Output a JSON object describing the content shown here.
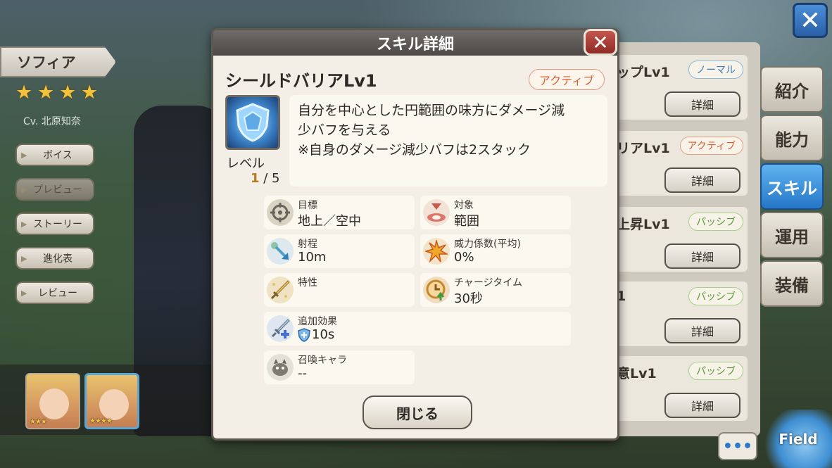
{
  "character": {
    "name": "ソフィア",
    "rarity_stars": 4,
    "cv": "Cv. 北原知奈"
  },
  "left_menu": [
    {
      "label": "ボイス",
      "enabled": true
    },
    {
      "label": "プレビュー",
      "enabled": false
    },
    {
      "label": "ストーリー",
      "enabled": true
    },
    {
      "label": "進化表",
      "enabled": true
    },
    {
      "label": "レビュー",
      "enabled": true
    }
  ],
  "portraits": [
    {
      "stars": "★★★",
      "selected": false
    },
    {
      "stars": "★★★★",
      "selected": true
    }
  ],
  "skill_list": [
    {
      "title": "ップLv1",
      "badge": "ノーマル",
      "badge_type": "normal",
      "button": "詳細"
    },
    {
      "title": "リアLv1",
      "badge": "アクティブ",
      "badge_type": "active",
      "button": "詳細"
    },
    {
      "title": "上昇Lv1",
      "badge": "パッシブ",
      "badge_type": "passive",
      "button": "詳細"
    },
    {
      "title": "1",
      "badge": "パッシブ",
      "badge_type": "passive",
      "button": "詳細"
    },
    {
      "title": "意Lv1",
      "badge": "パッシブ",
      "badge_type": "passive",
      "button": "詳細"
    }
  ],
  "tabs": [
    {
      "label": "紹介",
      "selected": false
    },
    {
      "label": "能力",
      "selected": false
    },
    {
      "label": "スキル",
      "selected": true
    },
    {
      "label": "運用",
      "selected": false
    },
    {
      "label": "装備",
      "selected": false
    }
  ],
  "field_button": "Field",
  "chat_button": "•••",
  "modal": {
    "header": "スキル詳細",
    "skill_name": "シールドバリアLv1",
    "skill_type": "アクティブ",
    "level_label": "レベル",
    "level_current": "1",
    "level_max": " / 5",
    "description_lines": [
      "自分を中心とした円範囲の味方にダメージ減",
      "少バフを与える",
      "※自身のダメージ減少バフは2スタック"
    ],
    "stats": {
      "target": {
        "key": "目標",
        "value": "地上／空中"
      },
      "scope": {
        "key": "対象",
        "value": "範囲"
      },
      "range": {
        "key": "射程",
        "value": "10m"
      },
      "power": {
        "key": "威力係数(平均)",
        "value": "0%"
      },
      "trait": {
        "key": "特性",
        "value": ""
      },
      "charge": {
        "key": "チャージタイム",
        "value": "30秒"
      },
      "extra": {
        "key": "追加効果",
        "value": "10s"
      },
      "summon": {
        "key": "召喚キャラ",
        "value": "--"
      }
    },
    "close_label": "閉じる"
  },
  "colors": {
    "accent_blue": "#2577c7",
    "active_orange": "#dc5e35",
    "passive_green": "#5c9a36",
    "normal_blue": "#3b79b5",
    "star_gold": "#f2c23a"
  }
}
